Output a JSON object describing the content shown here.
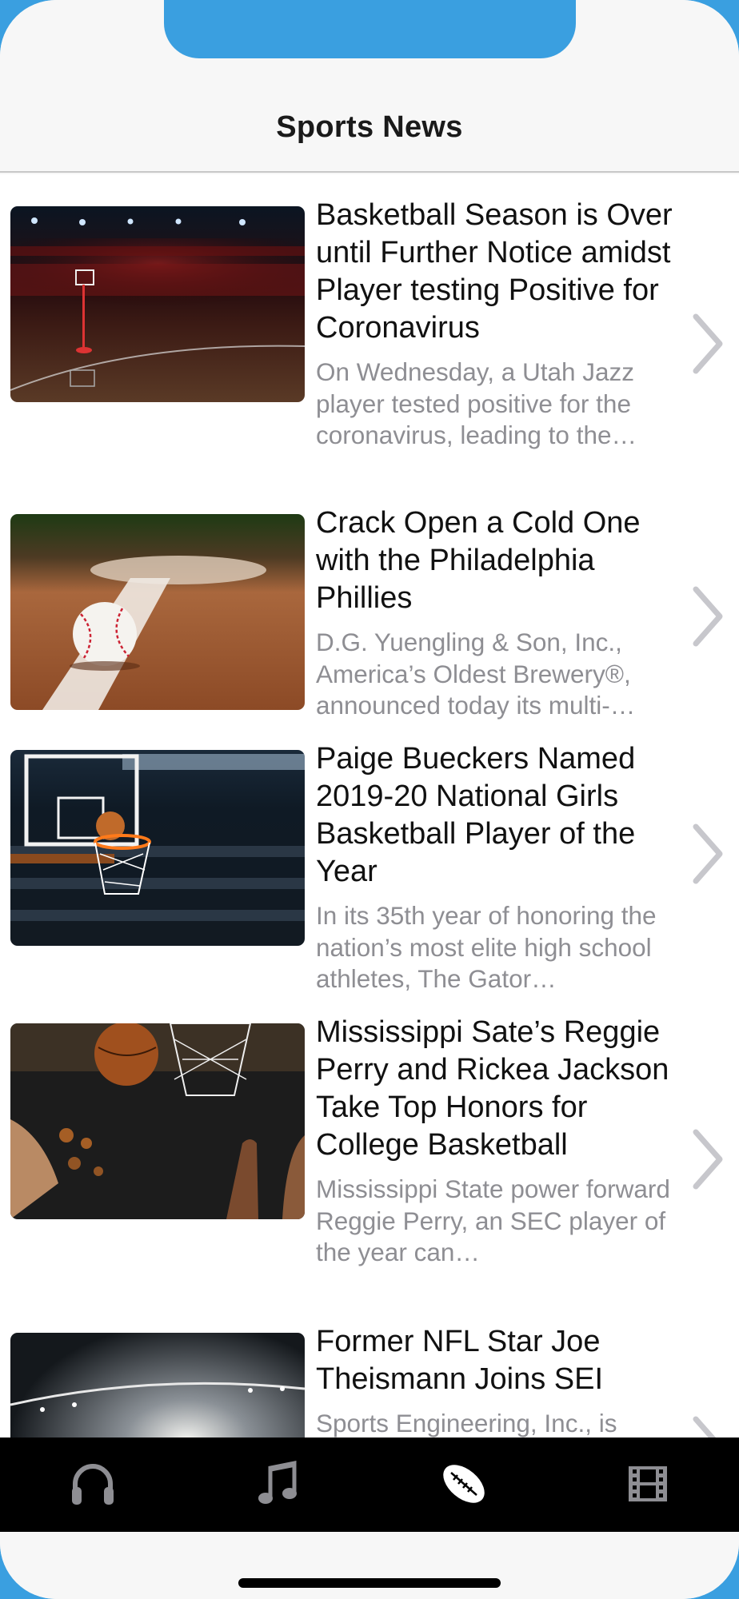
{
  "header": {
    "title": "Sports News"
  },
  "articles": [
    {
      "headline": "Basketball Season is Over until Further Notice amidst Player testing Positive for Coronavirus",
      "summary": "On Wednesday, a Utah Jazz player tested positive for the coronavirus, leading to the…",
      "image": "basketball-arena-image"
    },
    {
      "headline": "Crack Open a Cold One with the Philadelphia Phillies",
      "summary": "D.G. Yuengling & Son, Inc., America’s Oldest Brewery®, announced today its multi-…",
      "image": "baseball-on-field-image"
    },
    {
      "headline": "Paige Bueckers Named 2019-20 National Girls Basketball Player of the Year",
      "summary": "In its 35th year of honoring the nation’s most elite high school athletes, The Gator…",
      "image": "basketball-hoop-image"
    },
    {
      "headline": "Mississippi Sate’s Reggie Perry and Rickea Jackson Take Top Honors for College Basketball",
      "summary": "Mississippi State power forward Reggie Perry, an SEC player of the year can…",
      "image": "basketball-game-image"
    },
    {
      "headline": "Former NFL Star Joe Theismann Joins SEI",
      "summary": "Sports Engineering, Inc., is",
      "image": "stadium-lights-image"
    }
  ],
  "tabbar": {
    "tabs": [
      "headphones-icon",
      "music-note-icon",
      "football-icon",
      "film-icon"
    ],
    "selected": "football-icon"
  },
  "colors": {
    "accent_blue": "#3a9fe0",
    "tab_inactive": "#8e8e93",
    "tab_active": "#ffffff",
    "chevron": "#c7c7cc"
  }
}
